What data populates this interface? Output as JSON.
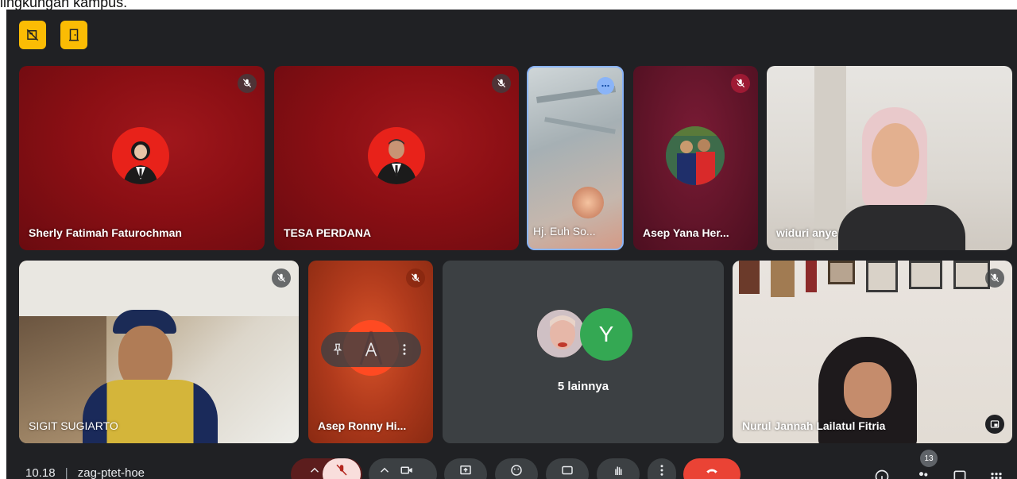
{
  "caption": "lingkungan kampus.",
  "top_buttons": [
    {
      "icon": "no-camera-icon"
    },
    {
      "icon": "door-exit-icon"
    }
  ],
  "participants": [
    {
      "name": "Sherly Fatimah Faturochman",
      "muted": true
    },
    {
      "name": "TESA PERDANA",
      "muted": true
    },
    {
      "name": "Hj. Euh So...",
      "muted": false
    },
    {
      "name": "Asep Yana Her...",
      "muted": true
    },
    {
      "name": "widuri anye",
      "muted": false
    },
    {
      "name": "SIGIT SUGIARTO",
      "muted": true
    },
    {
      "name": "Asep Ronny Hi...",
      "muted": true
    },
    {
      "name": "Nurul Jannah Lailatul Fitria",
      "muted": true
    }
  ],
  "others_tile": {
    "avatar_letter": "Y",
    "label": "5 lainnya"
  },
  "bottom": {
    "time": "10.18",
    "separator": "|",
    "meeting_code": "zag-ptet-hoe",
    "participant_count": "13"
  },
  "colors": {
    "accent_yellow": "#fbbc04",
    "end_call_red": "#ea4335",
    "avatar_green": "#34a853",
    "background": "#202124"
  }
}
